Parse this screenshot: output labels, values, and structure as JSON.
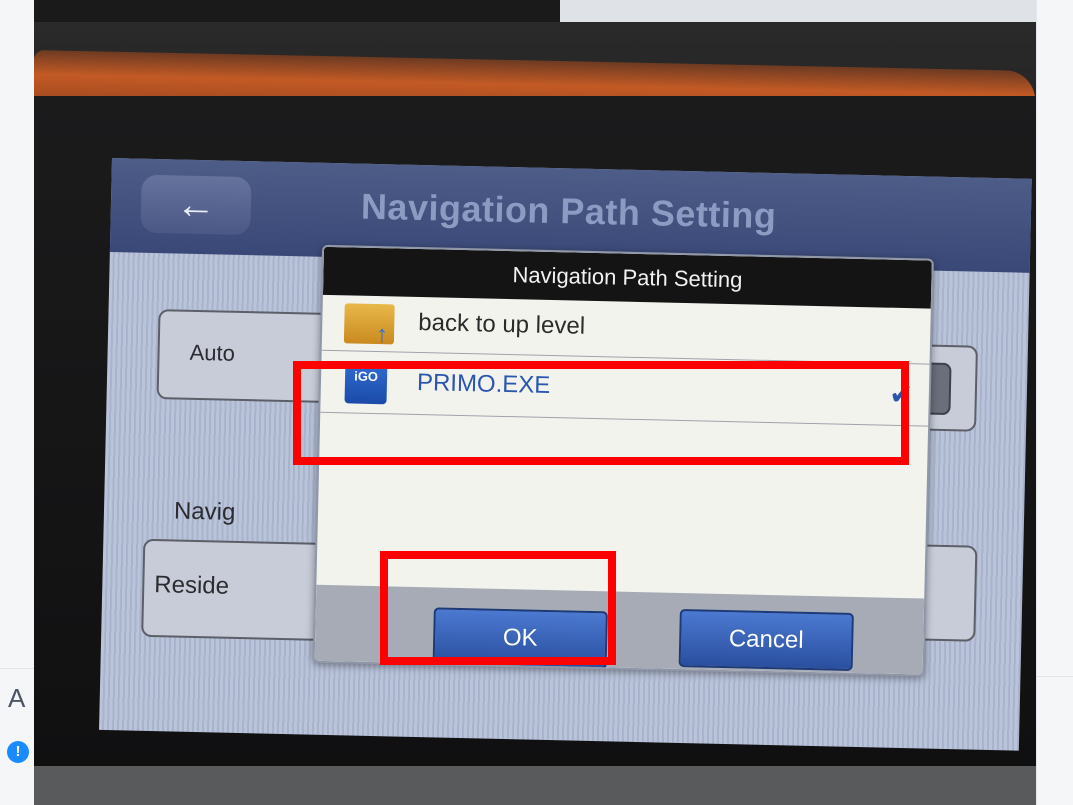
{
  "page": {
    "partial_letter": "A",
    "info_icon": "info-icon"
  },
  "device_screen": {
    "title": "Navigation Path Setting",
    "back_icon": "left-arrow-icon",
    "background_labels": {
      "auto": "Auto",
      "navig": "Navig",
      "reside": "Reside"
    }
  },
  "dialog": {
    "title": "Navigation Path Setting",
    "items": [
      {
        "label": "back to up level",
        "icon": "folder-up-icon",
        "selected": false
      },
      {
        "label": "PRIMO.EXE",
        "icon": "igo-app-icon",
        "icon_text": "iGO",
        "selected": true
      }
    ],
    "buttons": {
      "ok": "OK",
      "cancel": "Cancel"
    }
  },
  "highlight_color": "#ff0000",
  "colors": {
    "dialog_title_bg": "#141414",
    "button_blue": "#2a4f9f",
    "screen_header": "#3a4878",
    "selected_text": "#2a56b0"
  }
}
